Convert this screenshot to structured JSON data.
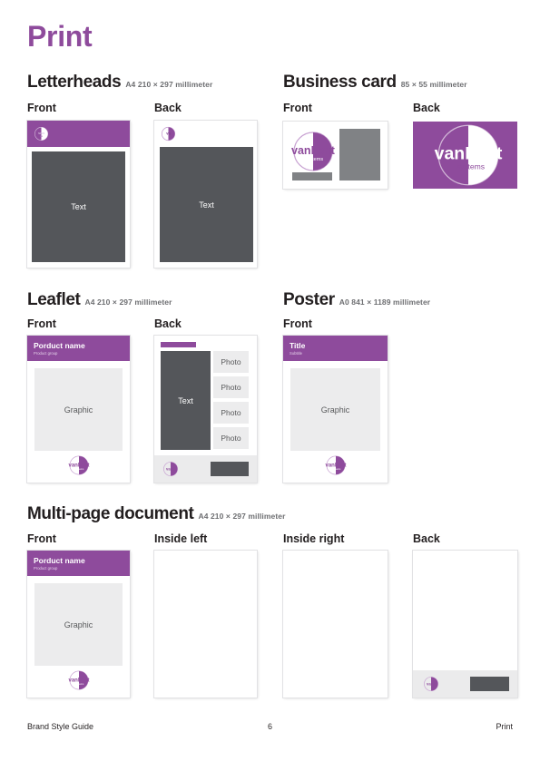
{
  "colors": {
    "brand_purple": "#8e4b9c",
    "dark_gray": "#54565a",
    "mid_gray": "#808285",
    "light_gray": "#ececed",
    "text_black": "#231f20"
  },
  "page": {
    "title": "Print"
  },
  "logo": {
    "wordmark_van": "van",
    "wordmark_lent": "Lent",
    "tagline": "systems"
  },
  "sections": [
    {
      "id": "letterheads",
      "title": "Letterheads",
      "dims": "A4 210 × 297 millimeter",
      "panels": [
        {
          "id": "front",
          "label": "Front",
          "text_block": "Text"
        },
        {
          "id": "back",
          "label": "Back",
          "text_block": "Text"
        }
      ]
    },
    {
      "id": "business-card",
      "title": "Business card",
      "dims": "85 × 55 millimeter",
      "panels": [
        {
          "id": "front",
          "label": "Front"
        },
        {
          "id": "back",
          "label": "Back"
        }
      ]
    },
    {
      "id": "leaflet",
      "title": "Leaflet",
      "dims": "A4 210 × 297 millimeter",
      "panels": [
        {
          "id": "front",
          "label": "Front",
          "product_name": "Porduct name",
          "product_group": "Product group",
          "graphic_block": "Graphic"
        },
        {
          "id": "back",
          "label": "Back",
          "text_block": "Text",
          "photos": [
            "Photo",
            "Photo",
            "Photo",
            "Photo"
          ]
        }
      ]
    },
    {
      "id": "poster",
      "title": "Poster",
      "dims": "A0 841 × 1189 millimeter",
      "panels": [
        {
          "id": "front",
          "label": "Front",
          "product_name": "Title",
          "product_group": "Subtitle",
          "graphic_block": "Graphic"
        }
      ]
    },
    {
      "id": "multi-page-document",
      "title": "Multi-page document",
      "dims": "A4 210 × 297 millimeter",
      "panels": [
        {
          "id": "front",
          "label": "Front",
          "product_name": "Porduct name",
          "product_group": "Product group",
          "graphic_block": "Graphic"
        },
        {
          "id": "inside-left",
          "label": "Inside left"
        },
        {
          "id": "inside-right",
          "label": "Inside right"
        },
        {
          "id": "back",
          "label": "Back"
        }
      ]
    }
  ],
  "footer": {
    "left": "Brand Style Guide",
    "page_number": "6",
    "right": "Print"
  }
}
